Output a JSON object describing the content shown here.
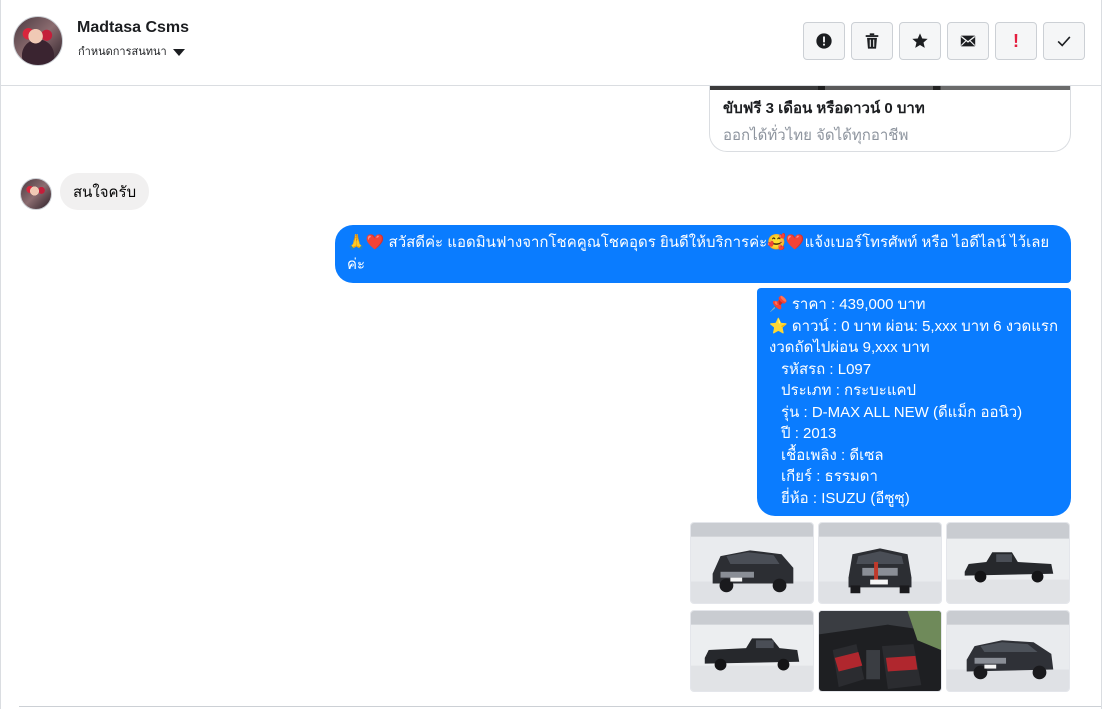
{
  "header": {
    "name": "Madtasa Csms",
    "subtitle": "กำหนดการสนทนา"
  },
  "toolbar": {
    "buttons": [
      {
        "name": "report-spam-button",
        "icon": "alert-circle-icon"
      },
      {
        "name": "delete-button",
        "icon": "trash-icon"
      },
      {
        "name": "star-button",
        "icon": "star-icon"
      },
      {
        "name": "mark-unread-button",
        "icon": "envelope-icon"
      },
      {
        "name": "follow-up-button",
        "icon": "exclamation-icon",
        "label": "!"
      },
      {
        "name": "mark-done-button",
        "icon": "check-icon"
      }
    ]
  },
  "link_preview": {
    "title": "ขับฟรี 3 เดือน หรือดาวน์ 0 บาท",
    "subtitle": "ออกได้ทั่วไทย จัดได้ทุกอาชีพ"
  },
  "incoming": {
    "text": "สนใจครับ"
  },
  "outgoing_1": {
    "prefix": "🙏",
    "heart": "❤️",
    "body": " สวัสดีค่ะ แอดมินฟางจากโชคคูณโชคอุดร ยินดีให้บริการค่ะ",
    "emoji2": "🥰",
    "heart2": "❤️",
    "tail": "แจ้งเบอร์โทรศัพท์ หรือ ไอดีไลน์  ไว้เลยค่ะ"
  },
  "outgoing_2": {
    "pin": "📌",
    "price": " ราคา : 439,000 บาท",
    "star": "⭐",
    "down": " ดาวน์ : 0 บาท ผ่อน: 5,xxx บาท 6 งวดแรก",
    "next": "งวดถัดไปผ่อน  9,xxx  บาท",
    "code": "รหัสรถ : L097",
    "type": "ประเภท : กระบะแคป",
    "model": "รุ่น : D-MAX ALL NEW (ดีแม็ก ออนิว)",
    "year": "ปี : 2013",
    "fuel": "เชื้อเพลิง : ดีเซล",
    "gear": "เกียร์ : ธรรมดา",
    "brand": "ยี่ห้อ : ISUZU (อีซูซุ)"
  },
  "photos": [
    {
      "name": "car-front-three-quarter"
    },
    {
      "name": "car-front"
    },
    {
      "name": "car-side"
    },
    {
      "name": "car-side-rear"
    },
    {
      "name": "car-interior"
    },
    {
      "name": "car-front-angle"
    }
  ],
  "colors": {
    "bubble_out": "#0a7cff",
    "bubble_in": "#f1f0f0",
    "follow_up": "#e41e3f"
  }
}
